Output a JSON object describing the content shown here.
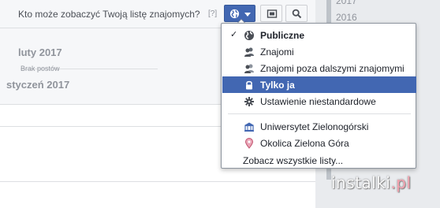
{
  "topbar": {
    "question": "Kto może zobaczyć Twoją listę znajomych?",
    "help": "[?]",
    "privacy_icon": "globe-icon",
    "caret_icon": "caret-down-icon",
    "edit_icon": "edit-icon",
    "search_icon": "search-icon"
  },
  "timeline": {
    "month_feb": "luty 2017",
    "no_posts": "Brak postów",
    "month_jan": "styczeń 2017"
  },
  "years": [
    "2017",
    "2016"
  ],
  "dropdown": {
    "items": [
      {
        "label": "Publiczne",
        "icon": "globe-icon",
        "checked": true,
        "bold": true
      },
      {
        "label": "Znajomi",
        "icon": "friends-icon",
        "checked": false
      },
      {
        "label": "Znajomi poza dalszymi znajomymi",
        "icon": "friends-except-icon",
        "checked": false
      },
      {
        "label": "Tylko ja",
        "icon": "lock-icon",
        "checked": false,
        "selected": true
      },
      {
        "label": "Ustawienie niestandardowe",
        "icon": "gear-icon",
        "checked": false
      },
      {
        "label": "Uniwersytet Zielonogórski",
        "icon": "building-icon",
        "checked": false
      },
      {
        "label": "Okolica Zielona Góra",
        "icon": "location-icon",
        "checked": false
      }
    ],
    "check_mark": "✓",
    "more": "Zobacz wszystkie listy..."
  },
  "watermark": {
    "main": "instalki",
    "accent": ".pl"
  },
  "colors": {
    "accent": "#4267b2",
    "selected_bg": "#4267b2",
    "muted": "#90949c"
  }
}
